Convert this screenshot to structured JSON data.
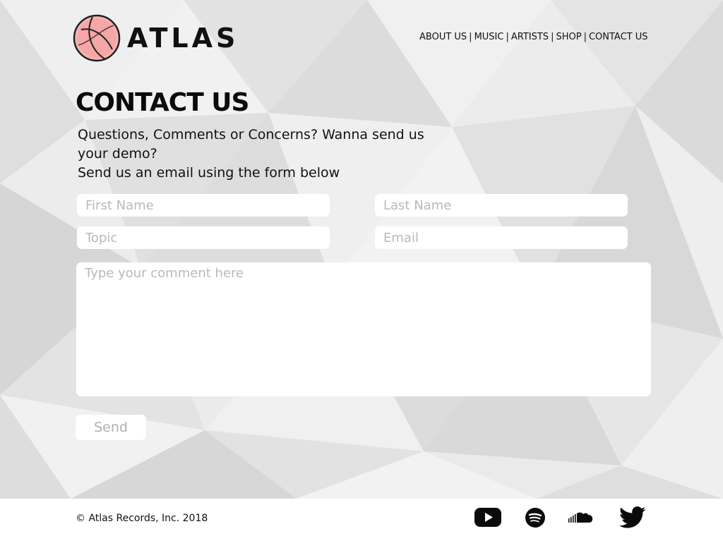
{
  "brand": {
    "name": "ATLAS",
    "logo_icon": "atlas-circle-logo",
    "accent": "#f7b4b4"
  },
  "nav": {
    "items": [
      {
        "label": "ABOUT US"
      },
      {
        "label": "MUSIC"
      },
      {
        "label": "ARTISTS"
      },
      {
        "label": "SHOP"
      },
      {
        "label": "CONTACT US"
      }
    ],
    "separator": "|"
  },
  "page": {
    "title": "CONTACT US",
    "intro_line1": "Questions, Comments or Concerns? Wanna send us your demo?",
    "intro_line2": "Send us an email using the form below"
  },
  "form": {
    "first_name_placeholder": "First Name",
    "last_name_placeholder": "Last Name",
    "topic_placeholder": "Topic",
    "email_placeholder": "Email",
    "comment_placeholder": "Type your comment here",
    "send_label": "Send"
  },
  "footer": {
    "copyright": "© Atlas Records, Inc. 2018",
    "social": [
      {
        "icon": "youtube-icon"
      },
      {
        "icon": "spotify-icon"
      },
      {
        "icon": "soundcloud-icon"
      },
      {
        "icon": "twitter-icon"
      }
    ]
  }
}
